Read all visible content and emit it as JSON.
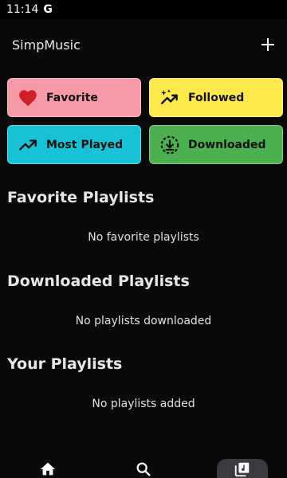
{
  "status_bar": {
    "time": "11:14",
    "g_glyph": "G"
  },
  "header": {
    "title": "SimpMusic",
    "add_icon": "plus-icon"
  },
  "tiles": [
    {
      "label": "Favorite",
      "icon": "heart-icon",
      "color": "#f59aa6"
    },
    {
      "label": "Followed",
      "icon": "trending-sparkle-icon",
      "color": "#fde94b"
    },
    {
      "label": "Most Played",
      "icon": "trending-up-icon",
      "color": "#18c2d6"
    },
    {
      "label": "Downloaded",
      "icon": "download-circle-icon",
      "color": "#4caf50"
    }
  ],
  "sections": {
    "favorite": {
      "title": "Favorite Playlists",
      "empty": "No favorite playlists"
    },
    "downloaded": {
      "title": "Downloaded Playlists",
      "empty": "No playlists downloaded"
    },
    "yours": {
      "title": "Your Playlists",
      "empty": "No playlists added"
    }
  },
  "bottom_nav": {
    "items": [
      {
        "icon": "home-icon",
        "selected": false
      },
      {
        "icon": "search-icon",
        "selected": false
      },
      {
        "icon": "library-music-icon",
        "selected": true
      }
    ]
  }
}
